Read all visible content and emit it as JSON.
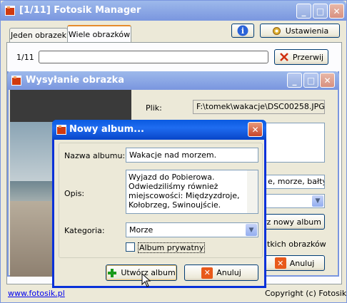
{
  "main_window": {
    "title": "[1/11] Fotosik Manager",
    "tabs": [
      "Jeden obrazek",
      "Wiele obrazków"
    ],
    "settings_label": "Ustawienia",
    "progress_text": "1/11",
    "cancel_label": "Przerwij",
    "footer_link": "www.fotosik.pl",
    "copyright": "Copyright (c) Fotosik.pl"
  },
  "upload_window": {
    "title": "Wysyłanie obrazka",
    "file_label": "Plik:",
    "file_value": "F:\\tomek\\wakacje\\DSC00258.JPG",
    "tags_value": "e, morze, bałtyk",
    "new_album_label": "órz nowy album",
    "all_images_label": "tkich obrazków",
    "cancel_label": "Anuluj"
  },
  "album_dialog": {
    "title": "Nowy album...",
    "name_label": "Nazwa albumu:",
    "name_value": "Wakacje nad morzem.",
    "desc_label": "Opis:",
    "desc_lines": [
      "Wyjazd do Pobierowa.",
      "Odwiedziliśmy również",
      "miejscowości: Międzyzdroje,",
      "Kołobrzeg, Swinoujście."
    ],
    "category_label": "Kategoria:",
    "category_value": "Morze",
    "private_label": "Album prywatny",
    "create_label": "Utwórz album",
    "cancel_label": "Anuluj"
  }
}
